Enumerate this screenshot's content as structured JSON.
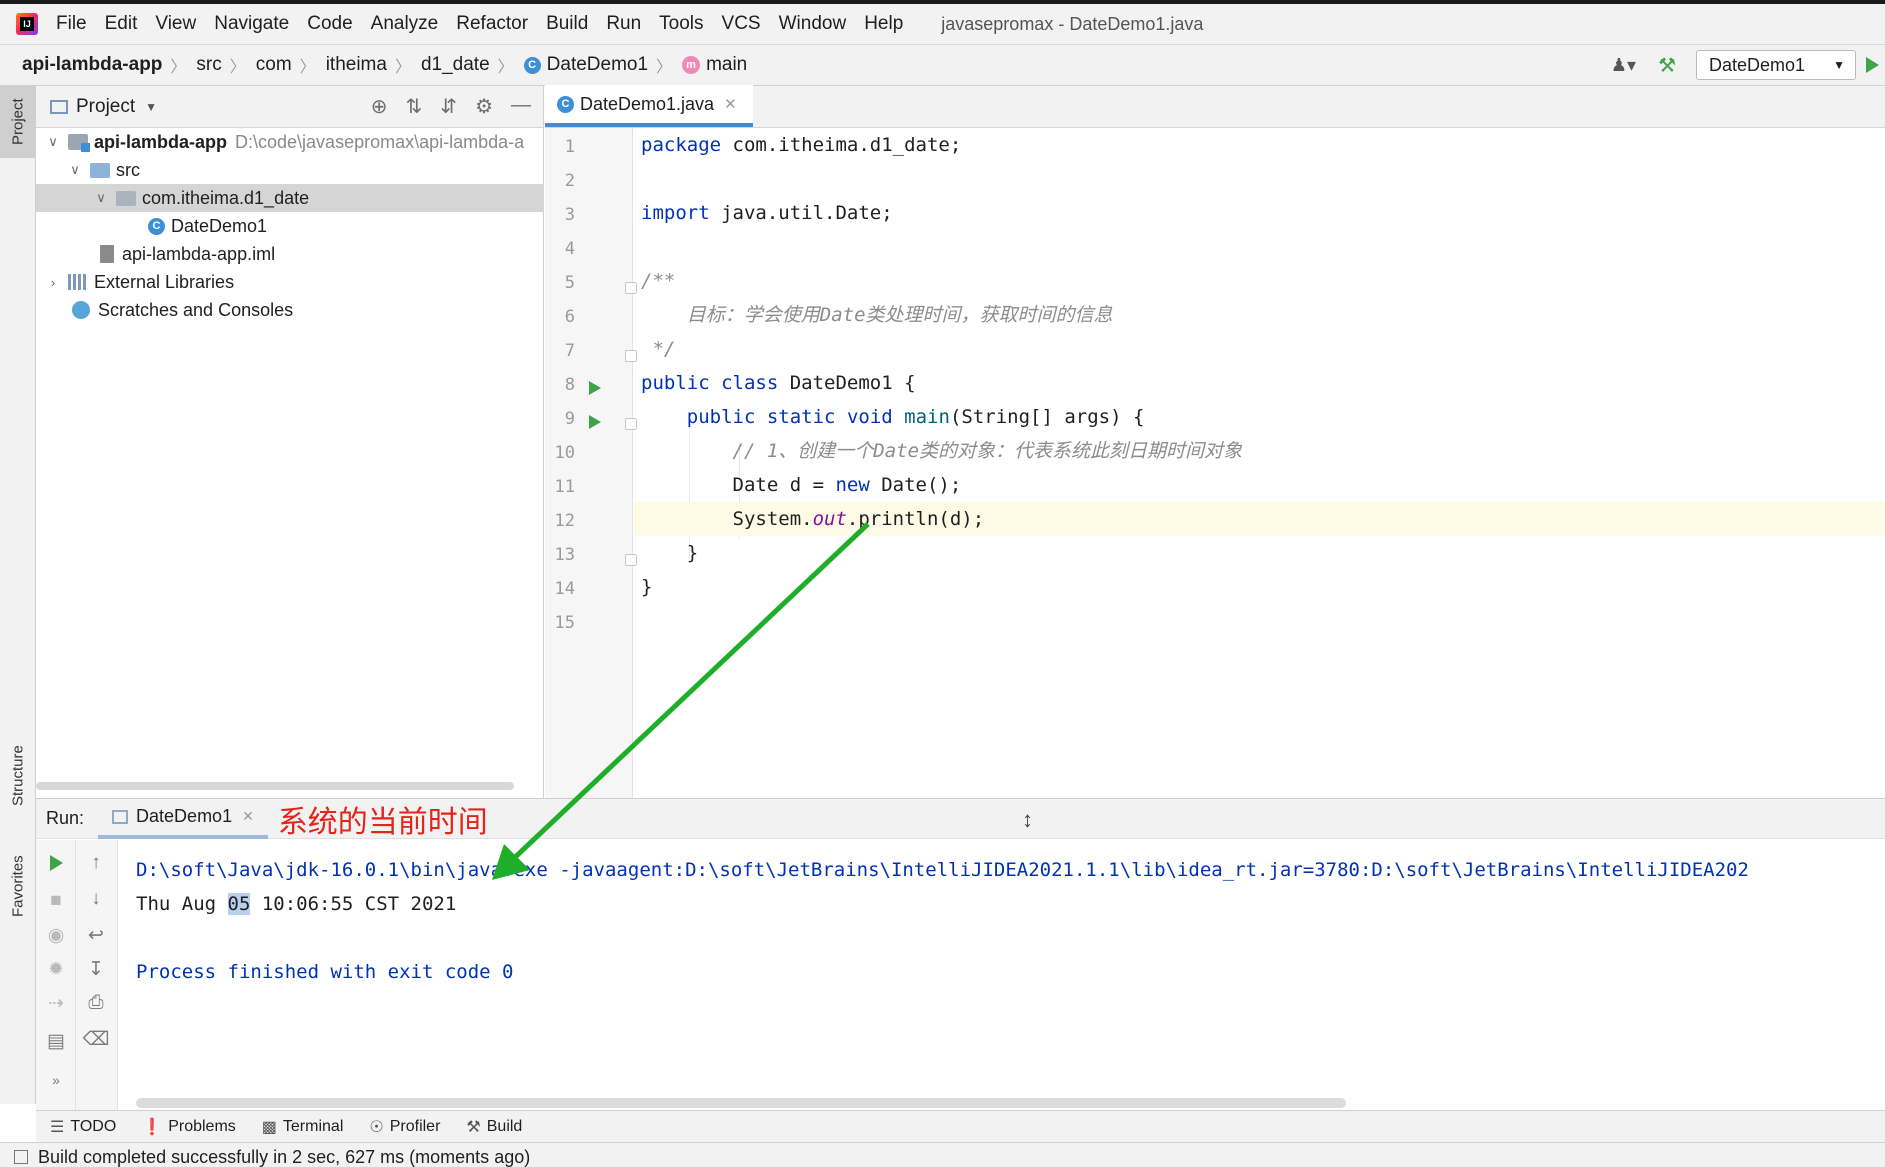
{
  "menu": {
    "items": [
      "File",
      "Edit",
      "View",
      "Navigate",
      "Code",
      "Analyze",
      "Refactor",
      "Build",
      "Run",
      "Tools",
      "VCS",
      "Window",
      "Help"
    ],
    "window_title": "javasepromax - DateDemo1.java"
  },
  "breadcrumb": [
    "api-lambda-app",
    "src",
    "com",
    "itheima",
    "d1_date",
    "DateDemo1",
    "main"
  ],
  "run_config": "DateDemo1",
  "left_stripe": {
    "project": "Project",
    "structure": "Structure",
    "favorites": "Favorites"
  },
  "project": {
    "title": "Project",
    "tree": [
      {
        "label": "api-lambda-app",
        "path": "D:\\code\\javasepromax\\api-lambda-a"
      },
      {
        "label": "src"
      },
      {
        "label": "com.itheima.d1_date"
      },
      {
        "label": "DateDemo1"
      },
      {
        "label": "api-lambda-app.iml"
      },
      {
        "label": "External Libraries"
      },
      {
        "label": "Scratches and Consoles"
      }
    ]
  },
  "editor": {
    "tab": "DateDemo1.java",
    "line_numbers": [
      "1",
      "2",
      "3",
      "4",
      "5",
      "6",
      "7",
      "8",
      "9",
      "10",
      "11",
      "12",
      "13",
      "14",
      "15"
    ],
    "code": {
      "l1_kw": "package",
      "l1_rest": " com.itheima.d1_date;",
      "l3_kw": "import",
      "l3_rest": " java.util.Date;",
      "l5": "/**",
      "l6": "    目标：学会使用Date类处理时间，获取时间的信息",
      "l7": " */",
      "l8_kw1": "public",
      "l8_kw2": "class",
      "l8_rest": " DateDemo1 {",
      "l9_indent": "    ",
      "l9_kw1": "public",
      "l9_kw2": "static",
      "l9_kw3": "void",
      "l9_fn": "main",
      "l9_rest": "(String[] args) {",
      "l10": "        // 1、创建一个Date类的对象：代表系统此刻日期时间对象",
      "l11_pre": "        Date d = ",
      "l11_kw": "new",
      "l11_rest": " Date();",
      "l12_pre": "        System.",
      "l12_fld": "out",
      "l12_rest": ".println(d);",
      "l13": "    }",
      "l14": "}"
    }
  },
  "run": {
    "label": "Run:",
    "tab": "DateDemo1",
    "annotation": "系统的当前时间",
    "console": {
      "cmd": "D:\\soft\\Java\\jdk-16.0.1\\bin\\java.exe -javaagent:D:\\soft\\JetBrains\\IntelliJIDEA2021.1.1\\lib\\idea_rt.jar=3780:D:\\soft\\JetBrains\\IntelliJIDEA202",
      "out_pre": "Thu Aug ",
      "out_hl": "05",
      "out_post": " 10:06:55 CST 2021",
      "finish": "Process finished with exit code 0"
    }
  },
  "bottom_tools": [
    "TODO",
    "Problems",
    "Terminal",
    "Profiler",
    "Build"
  ],
  "status": "Build completed successfully in 2 sec, 627 ms (moments ago)",
  "colors": {
    "keyword": "#0033b3",
    "comment": "#8c8c8c",
    "annotation": "#e1251b",
    "arrow": "#1fae2a"
  }
}
